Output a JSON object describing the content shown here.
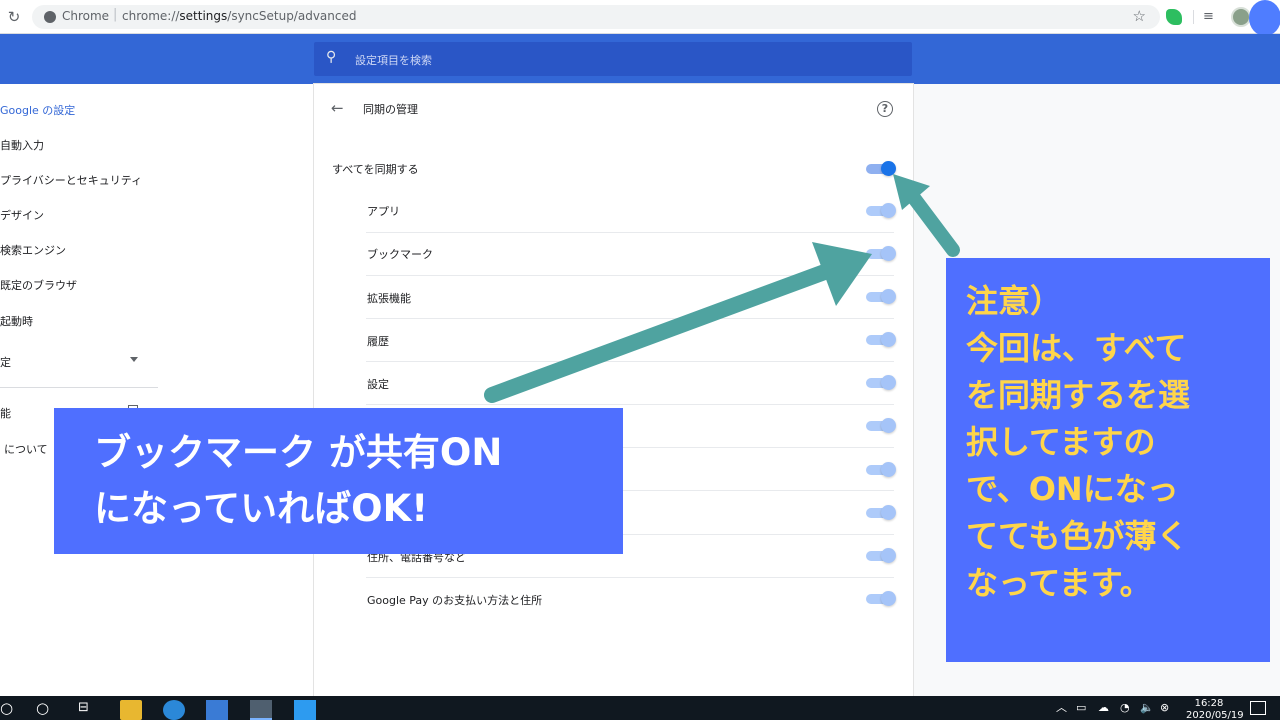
{
  "browser": {
    "site_label": "Chrome",
    "url_prefix": "chrome://",
    "url_host": "settings",
    "url_path": "/syncSetup/advanced"
  },
  "search": {
    "placeholder": "設定項目を検索"
  },
  "sidebar": {
    "items": [
      {
        "label": "Google の設定",
        "active": true
      },
      {
        "label": "自動入力"
      },
      {
        "label": "プライバシーとセキュリティ"
      },
      {
        "label": "デザイン"
      },
      {
        "label": "検索エンジン"
      },
      {
        "label": "既定のブラウザ"
      },
      {
        "label": "起動時"
      },
      {
        "label": "定"
      },
      {
        "label": "能"
      },
      {
        "label": "について"
      }
    ]
  },
  "page": {
    "title": "同期の管理",
    "sync_all": {
      "label": "すべてを同期する",
      "checked": true
    },
    "rows": [
      {
        "label": "アプリ"
      },
      {
        "label": "ブックマーク"
      },
      {
        "label": "拡張機能"
      },
      {
        "label": "履歴"
      },
      {
        "label": "設定"
      },
      {
        "label": ""
      },
      {
        "label": ""
      },
      {
        "label": ""
      },
      {
        "label": "住所、電話番号など"
      },
      {
        "label": "Google Pay のお支払い方法と住所"
      }
    ]
  },
  "annotation_left": {
    "line1": "ブックマーク が共有ON",
    "line2": "になっていればOK!"
  },
  "annotation_right": {
    "lines": [
      "注意）",
      "今回は、すべて",
      "を同期するを選",
      "択してますの",
      "で、ONになっ",
      "てても色が薄く",
      "なってます。"
    ]
  },
  "taskbar": {
    "time": "16:28",
    "date": "2020/05/19"
  },
  "colors": {
    "header": "#3367d6",
    "callout": "#4f6fff",
    "callout_right_text": "#ffd54a",
    "arrow": "#4fa3a0"
  }
}
